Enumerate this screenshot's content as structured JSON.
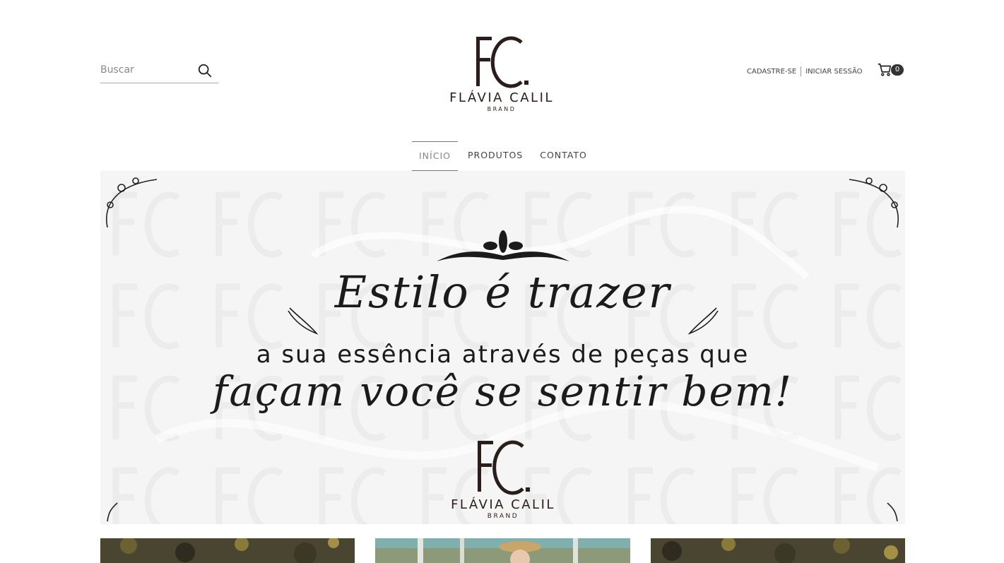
{
  "search": {
    "placeholder": "Buscar",
    "icon": "search-icon"
  },
  "logo": {
    "monogram": "FC.",
    "name": "FLÁVIA CALIL",
    "sub": "BRAND"
  },
  "account": {
    "register_label": "CADASTRE-SE",
    "login_label": "INICIAR SESSÃO"
  },
  "cart": {
    "icon": "cart-icon",
    "count": "0"
  },
  "nav": {
    "items": [
      {
        "label": "INÍCIO",
        "active": true
      },
      {
        "label": "PRODUTOS",
        "active": false
      },
      {
        "label": "CONTATO",
        "active": false
      }
    ]
  },
  "banner": {
    "line1": "Estilo é trazer",
    "line2": "a sua essência através de peças que",
    "line3": "façam você se sentir bem!",
    "logo_name": "FLÁVIA CALIL",
    "logo_sub": "BRAND"
  },
  "colors": {
    "text": "#222222",
    "brand": "#2a1d1b",
    "banner_bg": "#f5f5f5",
    "cart_badge": "#333333"
  }
}
